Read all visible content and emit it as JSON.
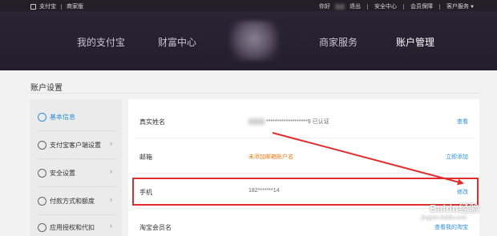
{
  "topbar": {
    "brand": "支付宝",
    "section": "商家版",
    "greeting": "你好",
    "logout": "退出",
    "security_center": "安全中心",
    "member_protection": "会员保障",
    "customer_service": "客户服务"
  },
  "nav": {
    "items": [
      "我的支付宝",
      "财富中心",
      "商家服务",
      "账户管理"
    ],
    "active_index": 3
  },
  "page": {
    "title": "账户设置"
  },
  "sidebar": {
    "items": [
      {
        "label": "基本信息",
        "icon": "user-icon",
        "active": true
      },
      {
        "label": "支付宝客户端设置",
        "icon": "phone-icon",
        "active": false
      },
      {
        "label": "安全设置",
        "icon": "shield-icon",
        "active": false
      },
      {
        "label": "付款方式和额度",
        "icon": "yen-icon",
        "active": false
      },
      {
        "label": "应用授权和代扣",
        "icon": "check-circle-icon",
        "active": false
      }
    ]
  },
  "rows": [
    {
      "label": "真实姓名",
      "value": "*******************9 已认证",
      "action": "查看"
    },
    {
      "label": "邮箱",
      "value": "未添加邮箱账户名",
      "action": "立即添加"
    },
    {
      "label": "手机",
      "value": "182*******14",
      "action": "修改"
    },
    {
      "label": "淘宝会员名",
      "value": "",
      "action": "查看我的淘宝"
    }
  ],
  "colors": {
    "nav_bg": "#231e2c",
    "accent_blue": "#2f8fd6",
    "warning_orange": "#f07a12",
    "highlight_red": "#e02e2e"
  },
  "watermark": {
    "brand": "Baidu经验",
    "url": "jingyan.baidu.com"
  }
}
